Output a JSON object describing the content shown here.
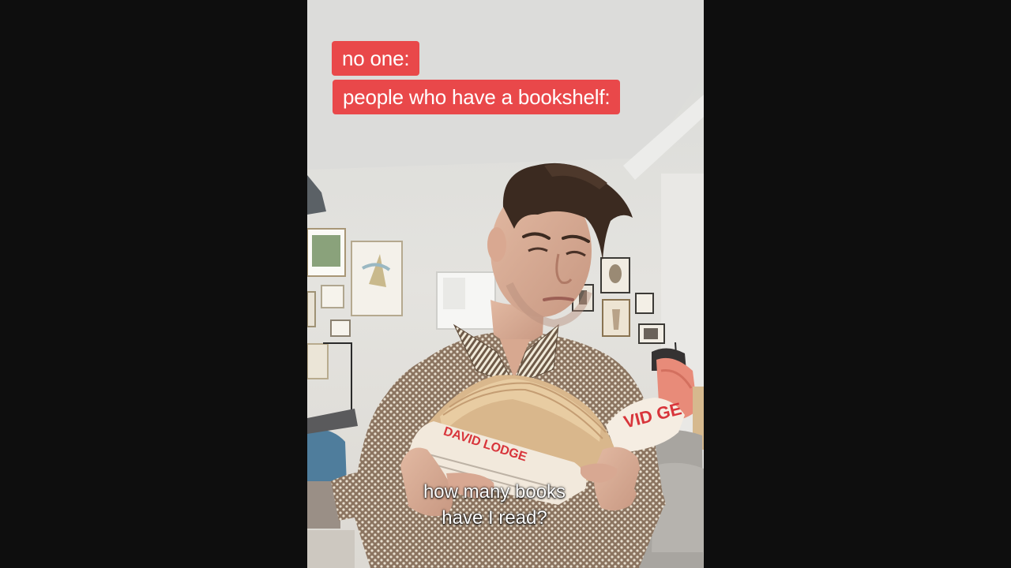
{
  "overlay": {
    "caption_line_1": "no one:",
    "caption_line_2": "people who have a bookshelf:",
    "caption_color": "#e9484a"
  },
  "subtitles": {
    "line_1": "how many books",
    "line_2": "have I read?"
  },
  "book_cover": {
    "author": "DAVID LODGE",
    "spine_text": "VID GE"
  }
}
